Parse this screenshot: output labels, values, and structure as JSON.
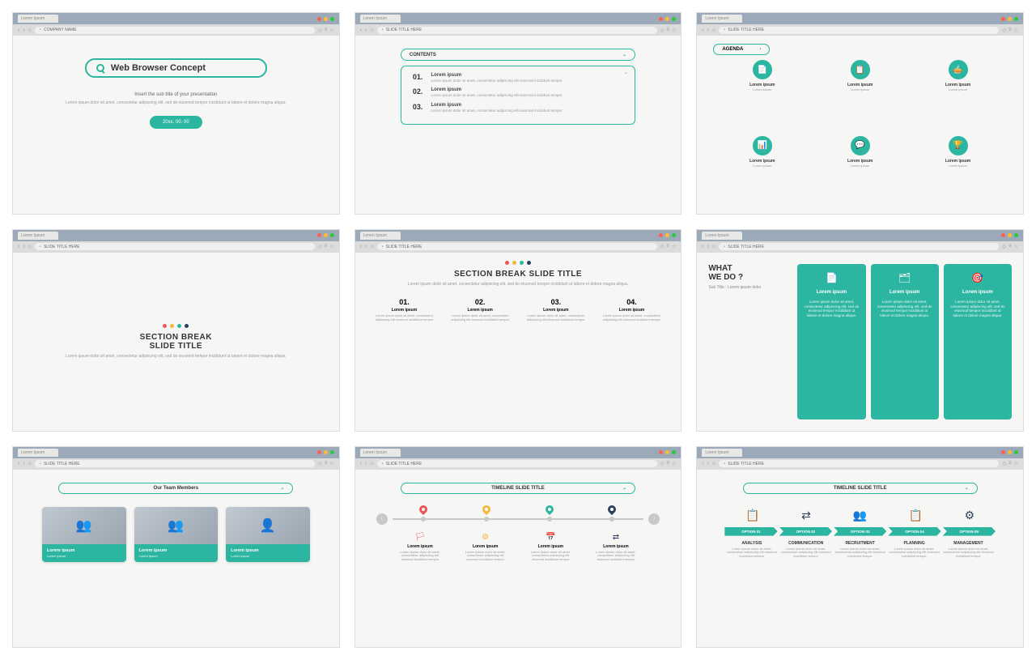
{
  "common": {
    "tab": "Lorem Ipsum",
    "url_company": "COMPANY NAME",
    "url_slide": "SLIDE TITLE HERE",
    "lorem_short": "Lorem ipsum",
    "lorem_line": "Lorem ipsum dolor sit amet, consectetur adipiscing elit, sed do eiusmod tempor incididunt ut labore et dolore magna aliqua.",
    "lorem_two": "Lorem ipsum dolor sit amet, consectetur adipiscing elit eiusmod incididunt tempor"
  },
  "s1": {
    "title": "Web Browser Concept",
    "sub": "Insert the sub title of your presentation",
    "chip": "20xx. 00. 00"
  },
  "s2": {
    "header": "CONTENTS",
    "items": [
      {
        "n": "01.",
        "t": "Lorem ipsum"
      },
      {
        "n": "02.",
        "t": "Lorem ipsum"
      },
      {
        "n": "03.",
        "t": "Lorem ipsum"
      }
    ]
  },
  "s3": {
    "header": "AGENDA",
    "icons": [
      "📄",
      "📋",
      "🥧",
      "📊",
      "💬",
      "🏆"
    ],
    "items": [
      "Lorem ipsum",
      "Lorem ipsum",
      "Lorem ipsum",
      "Lorem ipsum",
      "Lorem ipsum",
      "Lorem ipsum"
    ]
  },
  "s4": {
    "title": "SECTION BREAK\nSLIDE TITLE"
  },
  "s5": {
    "title": "SECTION BREAK SLIDE TITLE",
    "cols": [
      {
        "n": "01.",
        "t": "Lorem ipsum"
      },
      {
        "n": "02.",
        "t": "Lorem ipsum"
      },
      {
        "n": "03.",
        "t": "Lorem ipsum"
      },
      {
        "n": "04.",
        "t": "Lorem ipsum"
      }
    ]
  },
  "s6": {
    "title1": "WHAT",
    "title2": "WE DO ?",
    "sub": "Sub Title : Lorem ipsum dolor",
    "cards": [
      {
        "ic": "📄",
        "t": "Lorem ipsum"
      },
      {
        "ic": "🗂",
        "t": "Lorem ipsum"
      },
      {
        "ic": "🎯",
        "t": "Lorem ipsum"
      }
    ]
  },
  "s7": {
    "header": "Our Team Members",
    "members": [
      {
        "t": "Lorem ipsum"
      },
      {
        "t": "Lorem ipsum"
      },
      {
        "t": "Lorem ipsum"
      }
    ]
  },
  "s8": {
    "header": "TIMELINE SLIDE TITLE",
    "items": [
      {
        "ic": "🏳",
        "t": "Lorem ipsum"
      },
      {
        "ic": "⚙",
        "t": "Lorem ipsum"
      },
      {
        "ic": "📅",
        "t": "Lorem ipsum"
      },
      {
        "ic": "⇄",
        "t": "Lorem ipsum"
      }
    ]
  },
  "s9": {
    "header": "TIMELINE SLIDE TITLE",
    "icons": [
      "📋",
      "⇄",
      "👥",
      "📋",
      "⚙"
    ],
    "opts": [
      "OPTION 01",
      "OPTION 02",
      "OPTION 03",
      "OPTION 04",
      "OPTION 05"
    ],
    "stages": [
      "ANALYSIS",
      "COMMUNICATION",
      "RECRUITMENT",
      "PLANNING",
      "MANAGEMENT"
    ]
  }
}
